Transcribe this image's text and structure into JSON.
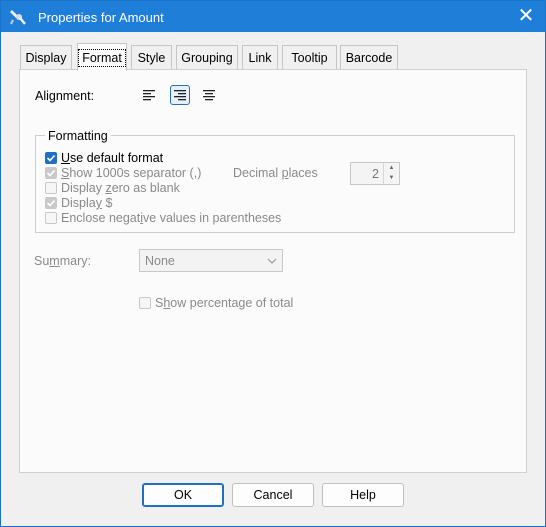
{
  "window": {
    "title": "Properties for Amount",
    "close_glyph": "✕"
  },
  "tabs": [
    {
      "label": "Display",
      "selected": false
    },
    {
      "label": "Format",
      "selected": true
    },
    {
      "label": "Style",
      "selected": false
    },
    {
      "label": "Grouping",
      "selected": false
    },
    {
      "label": "Link",
      "selected": false
    },
    {
      "label": "Tooltip",
      "selected": false
    },
    {
      "label": "Barcode",
      "selected": false
    }
  ],
  "alignment": {
    "label": "Alignment:",
    "options": [
      {
        "icon": "align-left-icon",
        "selected": false
      },
      {
        "icon": "align-right-icon",
        "selected": true
      },
      {
        "icon": "align-justify-icon",
        "selected": false
      }
    ]
  },
  "formatting": {
    "title": "Formatting",
    "use_default_format": {
      "pre": "",
      "ul": "U",
      "post": "se default format",
      "checked": true,
      "enabled": true
    },
    "show_1000s_separator": {
      "pre": "",
      "ul": "S",
      "post": "how 1000s separator (,)",
      "checked": true,
      "enabled": false
    },
    "display_zero_blank": {
      "pre": "Display ",
      "ul": "z",
      "post": "ero as blank",
      "checked": false,
      "enabled": false
    },
    "display_dollar": {
      "pre": "Displa",
      "ul": "y",
      "post": " $",
      "checked": true,
      "enabled": false
    },
    "enclose_negative": {
      "pre": "Enclose negat",
      "ul": "i",
      "post": "ve values in parentheses",
      "checked": false,
      "enabled": false
    },
    "decimal_places": {
      "pre": "Decimal ",
      "ul": "p",
      "post": "laces",
      "value": "2"
    }
  },
  "summary": {
    "pre": "Su",
    "ul": "m",
    "post": "mary:",
    "selected": "None"
  },
  "show_percentage": {
    "pre": "S",
    "ul": "h",
    "post": "ow percentage of total",
    "checked": false,
    "enabled": false
  },
  "buttons": {
    "ok": "OK",
    "cancel": "Cancel",
    "help": "Help"
  },
  "colors": {
    "title_bar": "#1e7ed8",
    "accent": "#1f6fc5"
  }
}
